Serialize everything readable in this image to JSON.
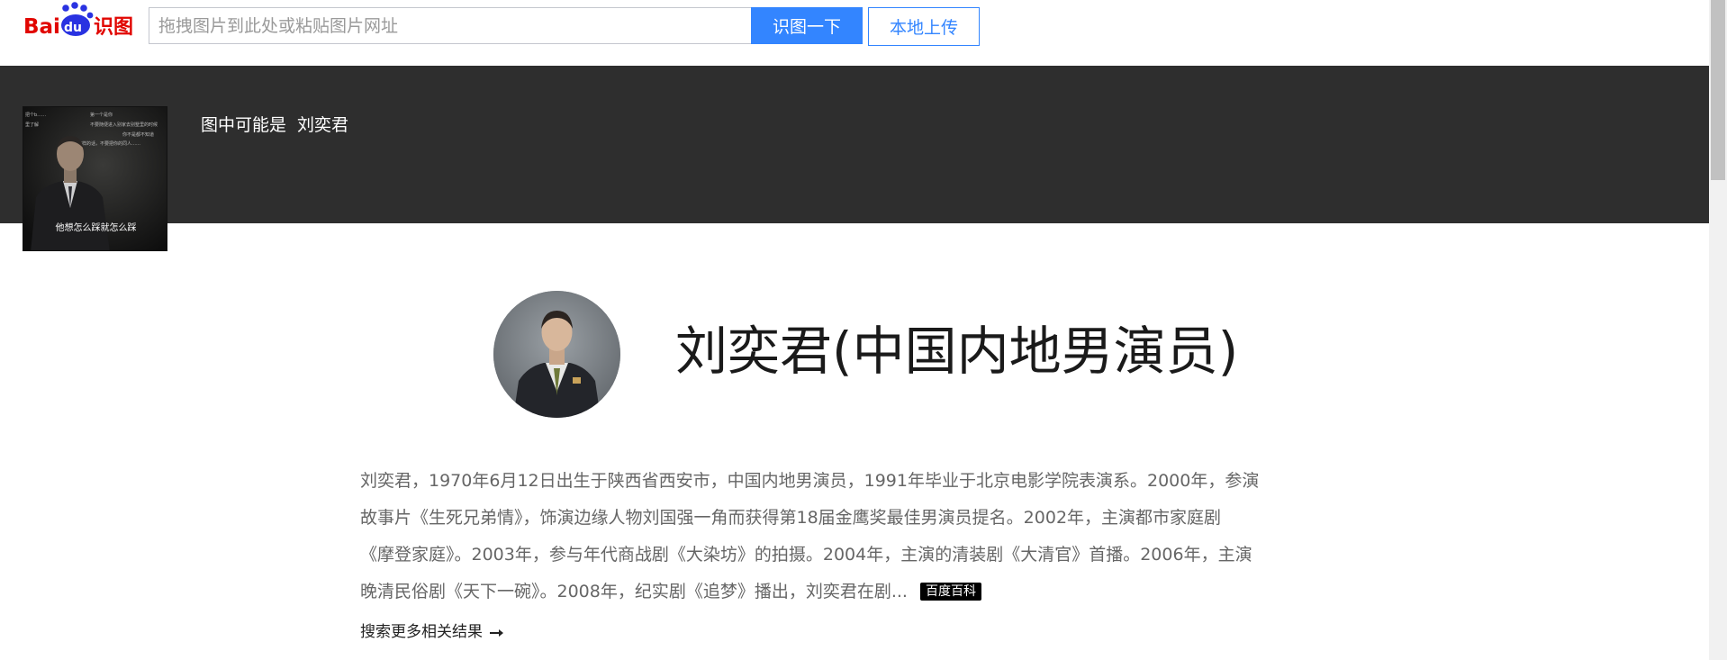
{
  "header": {
    "logo": {
      "text_bai": "Bai",
      "text_du": "du",
      "text_product": "识图",
      "icon": "paw-icon",
      "color_red": "#e10601",
      "color_blue": "#2932e1"
    },
    "search": {
      "value": "",
      "placeholder": "拖拽图片到此处或粘贴图片网址",
      "search_button": "识图一下",
      "upload_button": "本地上传"
    }
  },
  "query": {
    "thumbnail": {
      "subtitle": "他想怎么踩就怎么踩",
      "background_text_lines": [
        "把个b……",
        "里了解",
        "第一个是你",
        "不要随便进入别家去别墅里的时候",
        "你不是都不知道",
        "这样的话，不要把你的同人……"
      ]
    },
    "result_prefix": "图中可能是",
    "result_name": "刘奕君"
  },
  "result": {
    "title": "刘奕君(中国内地男演员)",
    "description_lines": [
      "刘奕君，1970年6月12日出生于陕西省西安市，中国内地男演员，1991年毕业于北京电影学院表演系。2000年，参演",
      "故事片《生死兄弟情》，饰演边缘人物刘国强一角而获得第18届金鹰奖最佳男演员提名。2002年，主演都市家庭剧",
      "《摩登家庭》。2003年，参与年代商战剧《大染坊》的拍摄。2004年，主演的清装剧《大清官》首播。2006年，主演",
      "晚清民俗剧《天下一碗》。2008年，纪实剧《追梦》播出，刘奕君在剧..."
    ],
    "source_badge": "百度百科",
    "more_link": "搜索更多相关结果",
    "more_icon": "arrow-right-icon"
  },
  "colors": {
    "accent": "#3385ff",
    "banner_bg": "#2e2e2e",
    "desc_text": "#666666"
  }
}
